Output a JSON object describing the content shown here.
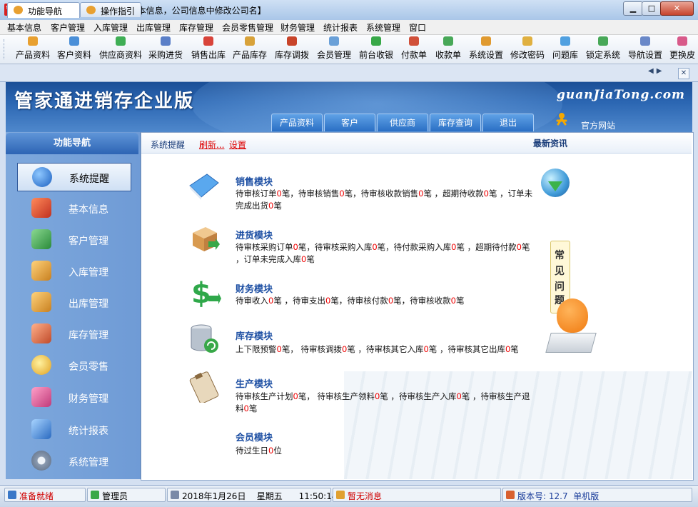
{
  "window": {
    "title": "管家通进销存企业版--【请在基本信息，公司信息中修改公司名】"
  },
  "menu": [
    "基本信息",
    "客户管理",
    "入库管理",
    "出库管理",
    "库存管理",
    "会员零售管理",
    "财务管理",
    "统计报表",
    "系统管理",
    "窗口"
  ],
  "toolbar": [
    {
      "label": "产品资料",
      "icon": "product-icon",
      "color": "#e8a030"
    },
    {
      "label": "客户资料",
      "icon": "customer-icon",
      "color": "#4a8fd8"
    },
    {
      "label": "供应商资料",
      "icon": "supplier-icon",
      "color": "#3fae55"
    },
    {
      "label": "采购进货",
      "icon": "purchase-icon",
      "color": "#5a7fc8"
    },
    {
      "label": "销售出库",
      "icon": "sales-out-icon",
      "color": "#d8443a"
    },
    {
      "label": "产品库存",
      "icon": "stock-icon",
      "color": "#d8a23a"
    },
    {
      "label": "库存调拨",
      "icon": "transfer-icon",
      "color": "#c8442a"
    },
    {
      "label": "会员管理",
      "icon": "member-icon",
      "color": "#6aa0d8"
    },
    {
      "label": "前台收银",
      "icon": "cashier-icon",
      "color": "#38a848"
    },
    {
      "label": "付款单",
      "icon": "payment-icon",
      "color": "#d0503a"
    },
    {
      "label": "收款单",
      "icon": "receipt-icon",
      "color": "#48a858"
    },
    {
      "label": "系统设置",
      "icon": "settings-icon",
      "color": "#e09a30"
    },
    {
      "label": "修改密码",
      "icon": "password-icon",
      "color": "#e0b040"
    },
    {
      "label": "问题库",
      "icon": "faq-icon",
      "color": "#50a0e0"
    },
    {
      "label": "锁定系统",
      "icon": "lock-icon",
      "color": "#48a858"
    },
    {
      "label": "导航设置",
      "icon": "nav-settings-icon",
      "color": "#6a88c8"
    },
    {
      "label": "更换皮",
      "icon": "skin-icon",
      "color": "#d85a8a"
    }
  ],
  "tabs": [
    {
      "label": "功能导航",
      "active": true
    },
    {
      "label": "操作指引",
      "active": false
    }
  ],
  "banner": {
    "title": "管家通进销存企业版",
    "domain": "guanJiaTong.com",
    "tabs": [
      "产品资料",
      "客户",
      "供应商",
      "库存查询",
      "退出"
    ],
    "official_site": "官方网站"
  },
  "nav": {
    "header": "功能导航",
    "items": [
      {
        "label": "系统提醒",
        "icon": "info-icon",
        "color": "#2a78d8",
        "active": true
      },
      {
        "label": "基本信息",
        "icon": "cubes-icon",
        "color": "#e05a3a"
      },
      {
        "label": "客户管理",
        "icon": "users-icon",
        "color": "#3aa848"
      },
      {
        "label": "入库管理",
        "icon": "box-in-icon",
        "color": "#e0a030"
      },
      {
        "label": "出库管理",
        "icon": "box-out-icon",
        "color": "#e0a030"
      },
      {
        "label": "库存管理",
        "icon": "warehouse-icon",
        "color": "#d8603a"
      },
      {
        "label": "会员零售",
        "icon": "member-icon",
        "color": "#f0c040"
      },
      {
        "label": "财务管理",
        "icon": "finance-icon",
        "color": "#e06a9a"
      },
      {
        "label": "统计报表",
        "icon": "chart-icon",
        "color": "#4a88d0"
      },
      {
        "label": "系统管理",
        "icon": "gears-icon",
        "color": "#8a9ab0"
      }
    ]
  },
  "main": {
    "tip_label": "系统提醒",
    "refresh": "刷新...",
    "settings": "设置",
    "news": "最新资讯",
    "faq": [
      "常",
      "见",
      "问",
      "题"
    ]
  },
  "modules": [
    {
      "title": "销售模块",
      "icon": "book-icon",
      "color": "#4a9ae0",
      "items": [
        [
          "待审核订单",
          "0",
          "笔，"
        ],
        [
          "待审核销售",
          "0",
          "笔，"
        ],
        [
          "待审核收款销售",
          "0",
          "笔 ，"
        ],
        [
          "超期待收款",
          "0",
          "笔 ，"
        ],
        [
          "订单未完成出货",
          "0",
          "笔"
        ]
      ]
    },
    {
      "title": "进货模块",
      "icon": "package-icon",
      "color": "#d8a050",
      "items": [
        [
          "待审核采购订单",
          "0",
          "笔，"
        ],
        [
          "待审核采购入库",
          "0",
          "笔，"
        ],
        [
          "待付款采购入库",
          "0",
          "笔 ，"
        ],
        [
          "超期待付款",
          "0",
          "笔 ，"
        ],
        [
          "订单未完成入库",
          "0",
          "笔"
        ]
      ]
    },
    {
      "title": "财务模块",
      "icon": "money-icon",
      "color": "#38a848",
      "items": [
        [
          "待审收入",
          "0",
          "笔 ，"
        ],
        [
          "待审支出",
          "0",
          "笔，"
        ],
        [
          "待审核付款",
          "0",
          "笔，"
        ],
        [
          "待审核收款",
          "0",
          "笔"
        ]
      ]
    },
    {
      "title": "库存模块",
      "icon": "database-icon",
      "color": "#8090a8",
      "items": [
        [
          "上下限预警",
          "0",
          "笔，  "
        ],
        [
          "待审核调拨",
          "0",
          "笔 ，"
        ],
        [
          "待审核其它入库",
          "0",
          "笔 ，"
        ],
        [
          "待审核其它出库",
          "0",
          "笔"
        ]
      ]
    },
    {
      "title": "生产模块",
      "icon": "clipboard-icon",
      "color": "#c8a070",
      "items": [
        [
          "待审核生产计划",
          "0",
          "笔，  "
        ],
        [
          "待审核生产领料",
          "0",
          "笔 ，"
        ],
        [
          "待审核生产入库",
          "0",
          "笔 ，"
        ],
        [
          "待审核生产退料",
          "0",
          "笔"
        ]
      ]
    },
    {
      "title": "会员模块",
      "icon": "",
      "color": "",
      "items": [
        [
          "待过生日",
          "0",
          "位"
        ]
      ]
    }
  ],
  "status": [
    {
      "label": "准备就绪",
      "icon": "ready-icon",
      "color": "#3a78c8",
      "text_color": "#d00000"
    },
    {
      "label": "管理员",
      "icon": "user-icon",
      "color": "#3aa848",
      "text_color": "#000000"
    },
    {
      "label": "2018年1月26日    星期五      11:50:14",
      "icon": "clock-icon",
      "color": "#7a8aa8",
      "text_color": "#000000"
    },
    {
      "label": "暂无消息",
      "icon": "message-icon",
      "color": "#e0a030",
      "text_color": "#d00000"
    },
    {
      "label": "版本号: 12.7  单机版",
      "icon": "home-icon",
      "color": "#d86030",
      "text_color": "#1a3d9a"
    }
  ]
}
